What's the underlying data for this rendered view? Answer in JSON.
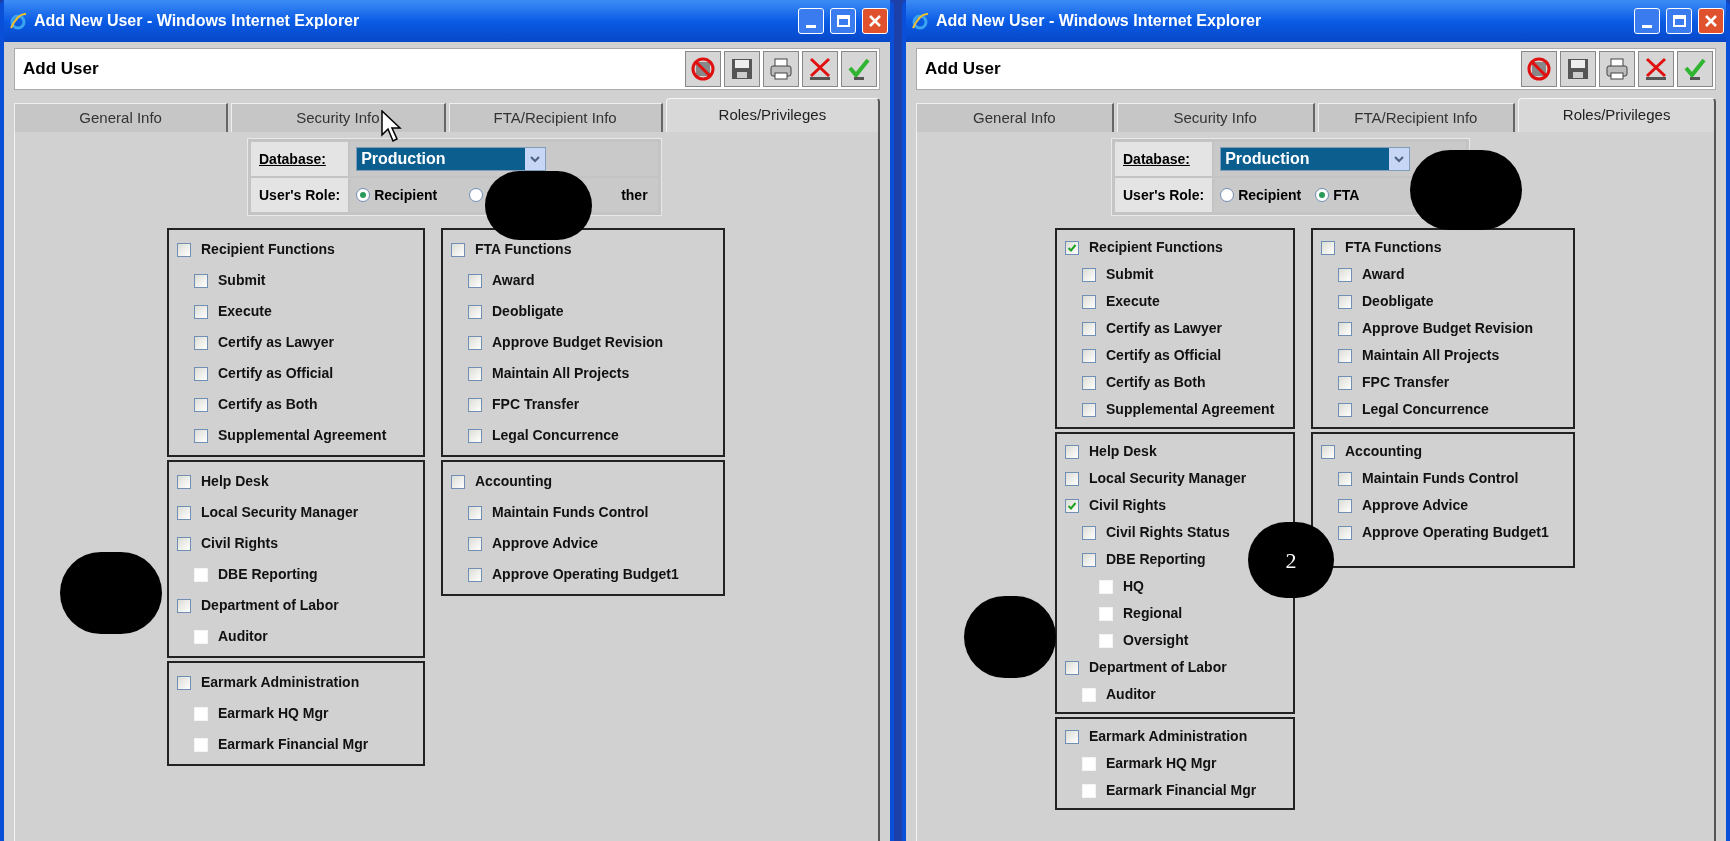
{
  "windows": [
    {
      "title": "Add New User - Windows Internet Explorer",
      "heading": "Add User",
      "tabs": [
        {
          "label": "General Info",
          "selected": false
        },
        {
          "label": "Security Info",
          "selected": false
        },
        {
          "label": "FTA/Recipient Info",
          "selected": false
        },
        {
          "label": "Roles/Privileges",
          "selected": true
        }
      ],
      "database": {
        "label": "Database:",
        "value": "Production"
      },
      "role": {
        "label": "User's Role:",
        "options": [
          {
            "label": "Recipient",
            "selected": true
          },
          {
            "selected": false
          },
          {
            "label": "ther"
          }
        ]
      },
      "columns": [
        [
          {
            "items": [
              {
                "label": "Recipient Functions",
                "checked": false,
                "disabled": false,
                "children": [
                  {
                    "label": "Submit",
                    "checked": false,
                    "disabled": false
                  },
                  {
                    "label": "Execute",
                    "checked": false,
                    "disabled": false
                  },
                  {
                    "label": "Certify as Lawyer",
                    "checked": false,
                    "disabled": false
                  },
                  {
                    "label": "Certify as Official",
                    "checked": false,
                    "disabled": false
                  },
                  {
                    "label": "Certify as Both",
                    "checked": false,
                    "disabled": false
                  },
                  {
                    "label": "Supplemental Agreement",
                    "checked": false,
                    "disabled": false
                  }
                ]
              }
            ]
          },
          {
            "items": [
              {
                "label": "Help Desk",
                "checked": false,
                "disabled": false
              },
              {
                "label": "Local Security Manager",
                "checked": false,
                "disabled": false
              },
              {
                "label": "Civil Rights",
                "checked": false,
                "disabled": false,
                "children": [
                  {
                    "label": "DBE Reporting",
                    "checked": false,
                    "disabled": true
                  }
                ]
              },
              {
                "label": "Department of Labor",
                "checked": false,
                "disabled": false,
                "children": [
                  {
                    "label": "Auditor",
                    "checked": false,
                    "disabled": true
                  }
                ]
              }
            ]
          },
          {
            "items": [
              {
                "label": "Earmark Administration",
                "checked": false,
                "disabled": false,
                "children": [
                  {
                    "label": "Earmark HQ Mgr",
                    "checked": false,
                    "disabled": true
                  },
                  {
                    "label": "Earmark Financial Mgr",
                    "checked": false,
                    "disabled": true
                  }
                ]
              }
            ]
          }
        ],
        [
          {
            "items": [
              {
                "label": "FTA Functions",
                "checked": false,
                "disabled": false,
                "children": [
                  {
                    "label": "Award",
                    "checked": false,
                    "disabled": false
                  },
                  {
                    "label": "Deobligate",
                    "checked": false,
                    "disabled": false
                  },
                  {
                    "label": "Approve Budget Revision",
                    "checked": false,
                    "disabled": false
                  },
                  {
                    "label": "Maintain All Projects",
                    "checked": false,
                    "disabled": false
                  },
                  {
                    "label": "FPC Transfer",
                    "checked": false,
                    "disabled": false
                  },
                  {
                    "label": "Legal Concurrence",
                    "checked": false,
                    "disabled": false
                  }
                ]
              }
            ]
          },
          {
            "items": [
              {
                "label": "Accounting",
                "checked": false,
                "disabled": false,
                "children": [
                  {
                    "label": "Maintain Funds Control",
                    "checked": false,
                    "disabled": false
                  },
                  {
                    "label": "Approve Advice",
                    "checked": false,
                    "disabled": false
                  },
                  {
                    "label": "Approve Operating Budget1",
                    "checked": false,
                    "disabled": false
                  }
                ]
              }
            ]
          }
        ]
      ],
      "callouts": [
        {
          "kind": "blank"
        },
        {
          "kind": "blank"
        }
      ]
    },
    {
      "title": "Add New User - Windows Internet Explorer",
      "heading": "Add User",
      "tabs": [
        {
          "label": "General Info",
          "selected": false
        },
        {
          "label": "Security Info",
          "selected": false
        },
        {
          "label": "FTA/Recipient Info",
          "selected": false
        },
        {
          "label": "Roles/Privileges",
          "selected": true
        }
      ],
      "database": {
        "label": "Database:",
        "value": "Production"
      },
      "role": {
        "label": "User's Role:",
        "options": [
          {
            "label": "Recipient",
            "selected": false
          },
          {
            "label": "FTA",
            "selected": true
          }
        ]
      },
      "columns": [
        [
          {
            "items": [
              {
                "label": "Recipient Functions",
                "checked": true,
                "disabled": false,
                "children": [
                  {
                    "label": "Submit",
                    "checked": false,
                    "disabled": false
                  },
                  {
                    "label": "Execute",
                    "checked": false,
                    "disabled": false
                  },
                  {
                    "label": "Certify as Lawyer",
                    "checked": false,
                    "disabled": false
                  },
                  {
                    "label": "Certify as Official",
                    "checked": false,
                    "disabled": false
                  },
                  {
                    "label": "Certify as Both",
                    "checked": false,
                    "disabled": false
                  },
                  {
                    "label": "Supplemental Agreement",
                    "checked": false,
                    "disabled": false
                  }
                ]
              }
            ]
          },
          {
            "items": [
              {
                "label": "Help Desk",
                "checked": false,
                "disabled": false
              },
              {
                "label": "Local Security Manager",
                "checked": false,
                "disabled": false
              },
              {
                "label": "Civil Rights",
                "checked": true,
                "disabled": false,
                "children": [
                  {
                    "label": "Civil Rights Status",
                    "checked": false,
                    "disabled": false
                  },
                  {
                    "label": "DBE Reporting",
                    "checked": false,
                    "disabled": false,
                    "children": [
                      {
                        "label": "HQ",
                        "checked": false,
                        "disabled": true
                      },
                      {
                        "label": "Regional",
                        "checked": false,
                        "disabled": true
                      },
                      {
                        "label": "Oversight",
                        "checked": false,
                        "disabled": true
                      }
                    ]
                  }
                ]
              },
              {
                "label": "Department of Labor",
                "checked": false,
                "disabled": false,
                "children": [
                  {
                    "label": "Auditor",
                    "checked": false,
                    "disabled": true
                  }
                ]
              }
            ]
          },
          {
            "items": [
              {
                "label": "Earmark Administration",
                "checked": false,
                "disabled": false,
                "children": [
                  {
                    "label": "Earmark HQ Mgr",
                    "checked": false,
                    "disabled": true
                  },
                  {
                    "label": "Earmark Financial Mgr",
                    "checked": false,
                    "disabled": true
                  }
                ]
              }
            ]
          }
        ],
        [
          {
            "items": [
              {
                "label": "FTA Functions",
                "checked": false,
                "disabled": false,
                "children": [
                  {
                    "label": "Award",
                    "checked": false,
                    "disabled": false
                  },
                  {
                    "label": "Deobligate",
                    "checked": false,
                    "disabled": false
                  },
                  {
                    "label": "Approve Budget Revision",
                    "checked": false,
                    "disabled": false
                  },
                  {
                    "label": "Maintain All Projects",
                    "checked": false,
                    "disabled": false
                  },
                  {
                    "label": "FPC Transfer",
                    "checked": false,
                    "disabled": false
                  },
                  {
                    "label": "Legal Concurrence",
                    "checked": false,
                    "disabled": false
                  }
                ]
              }
            ]
          },
          {
            "items": [
              {
                "label": "Accounting",
                "checked": false,
                "disabled": false,
                "children": [
                  {
                    "label": "Maintain Funds Control",
                    "checked": false,
                    "disabled": false
                  },
                  {
                    "label": "Approve Advice",
                    "checked": false,
                    "disabled": false
                  },
                  {
                    "label": "Approve Operating Budget1",
                    "checked": false,
                    "disabled": false
                  }
                ]
              }
            ]
          }
        ]
      ],
      "callouts": [
        {
          "kind": "blank"
        },
        {
          "kind": "numbered",
          "label": "2"
        },
        {
          "kind": "blank"
        }
      ]
    }
  ]
}
